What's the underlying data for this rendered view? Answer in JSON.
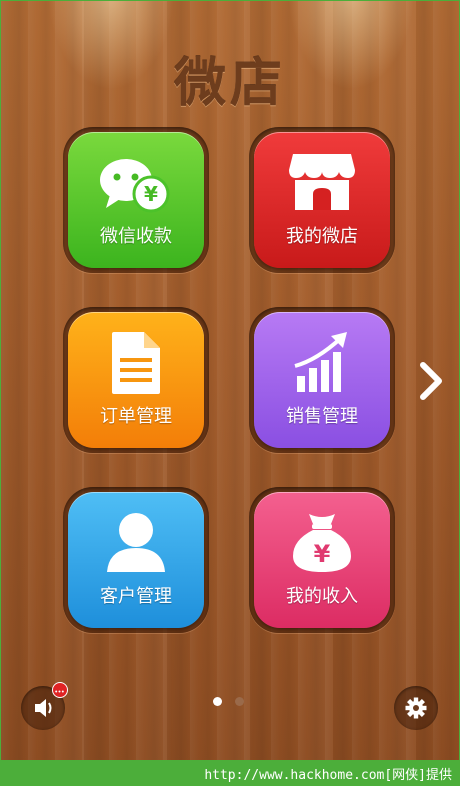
{
  "app": {
    "title": "微店"
  },
  "tiles": [
    {
      "label": "微信收款",
      "icon": "wechat-payment-icon",
      "color": "#4cc22a"
    },
    {
      "label": "我的微店",
      "icon": "shop-icon",
      "color": "#dc2626"
    },
    {
      "label": "订单管理",
      "icon": "document-icon",
      "color": "#f7960f"
    },
    {
      "label": "销售管理",
      "icon": "sales-chart-icon",
      "color": "#9b5ff0"
    },
    {
      "label": "客户管理",
      "icon": "user-icon",
      "color": "#2aa6e8"
    },
    {
      "label": "我的收入",
      "icon": "money-bag-icon",
      "color": "#e83f76"
    }
  ],
  "pager": {
    "pages": 2,
    "active": 1
  },
  "footer": {
    "credit": "http://www.hackhome.com[网侠]提供"
  },
  "colors": {
    "wood": "#a35d2c",
    "title": "#6e3d1d",
    "frame": "#4cae3a"
  }
}
